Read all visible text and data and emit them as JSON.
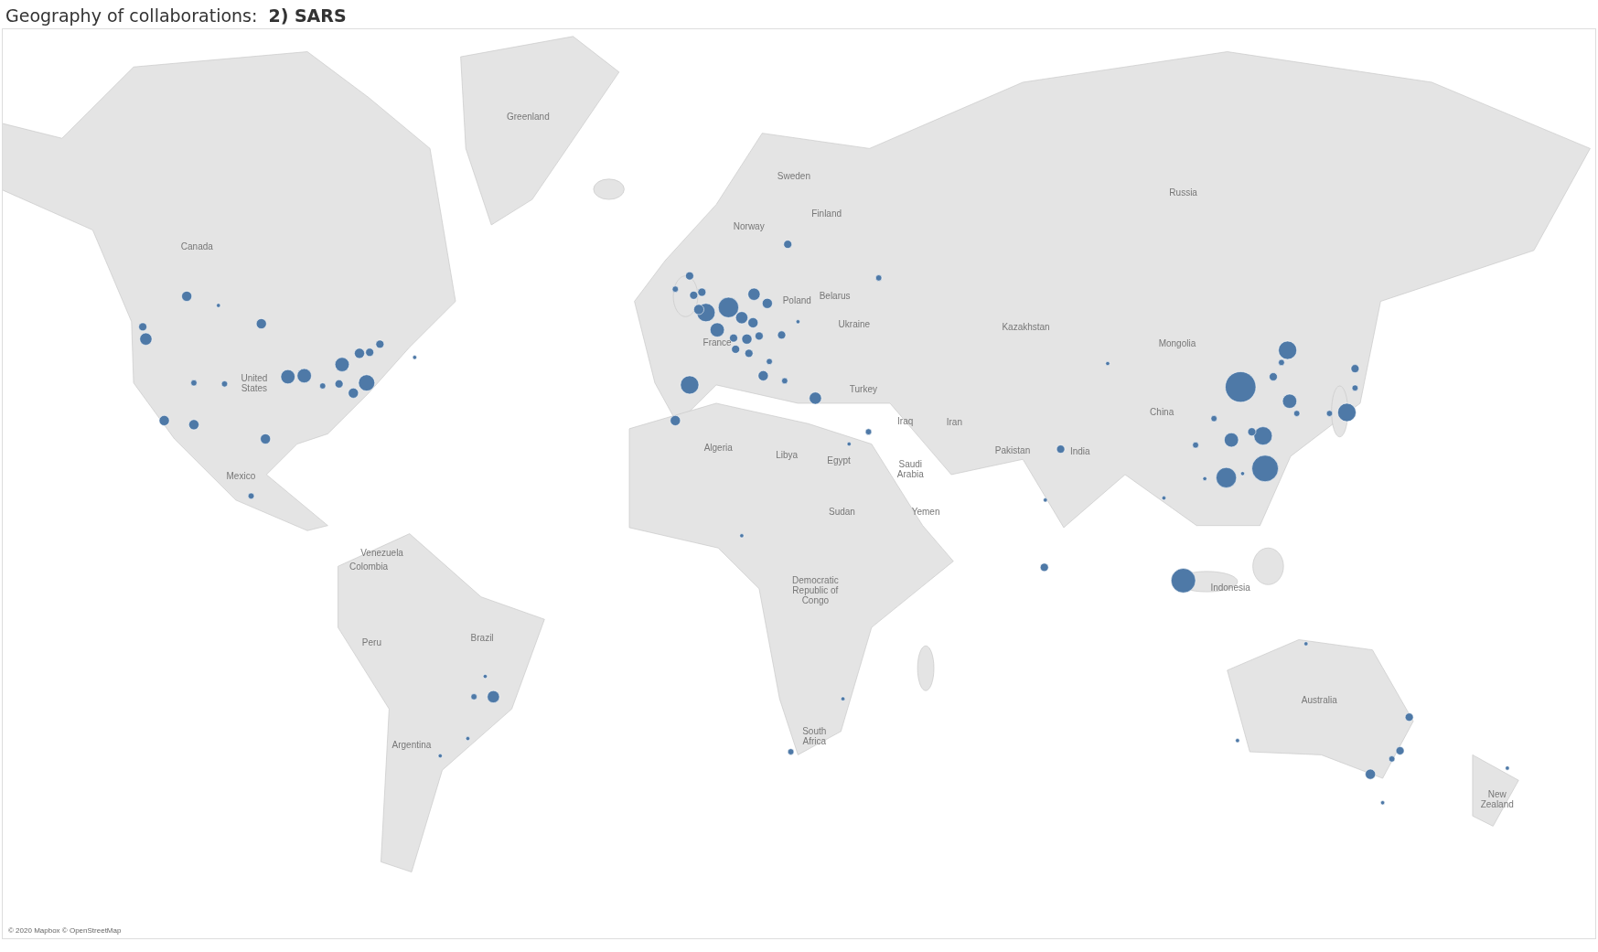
{
  "title": {
    "label": "Geography of collaborations:",
    "value": "2) SARS"
  },
  "map": {
    "labels": [
      "Greenland",
      "Canada",
      "Sweden",
      "Finland",
      "Norway",
      "Russia",
      "Poland",
      "Belarus",
      "Ukraine",
      "Kazakhstan",
      "Mongolia",
      "France",
      "United States",
      "Turkey",
      "Iraq",
      "Iran",
      "China",
      "Algeria",
      "Libya",
      "Egypt",
      "Saudi Arabia",
      "Pakistan",
      "India",
      "Mexico",
      "Sudan",
      "Yemen",
      "Venezuela",
      "Colombia",
      "Indonesia",
      "Democratic Republic of Congo",
      "Brazil",
      "Peru",
      "Australia",
      "Argentina",
      "South Africa",
      "New Zealand"
    ],
    "attribution": "© 2020 Mapbox © OpenStreetMap"
  }
}
